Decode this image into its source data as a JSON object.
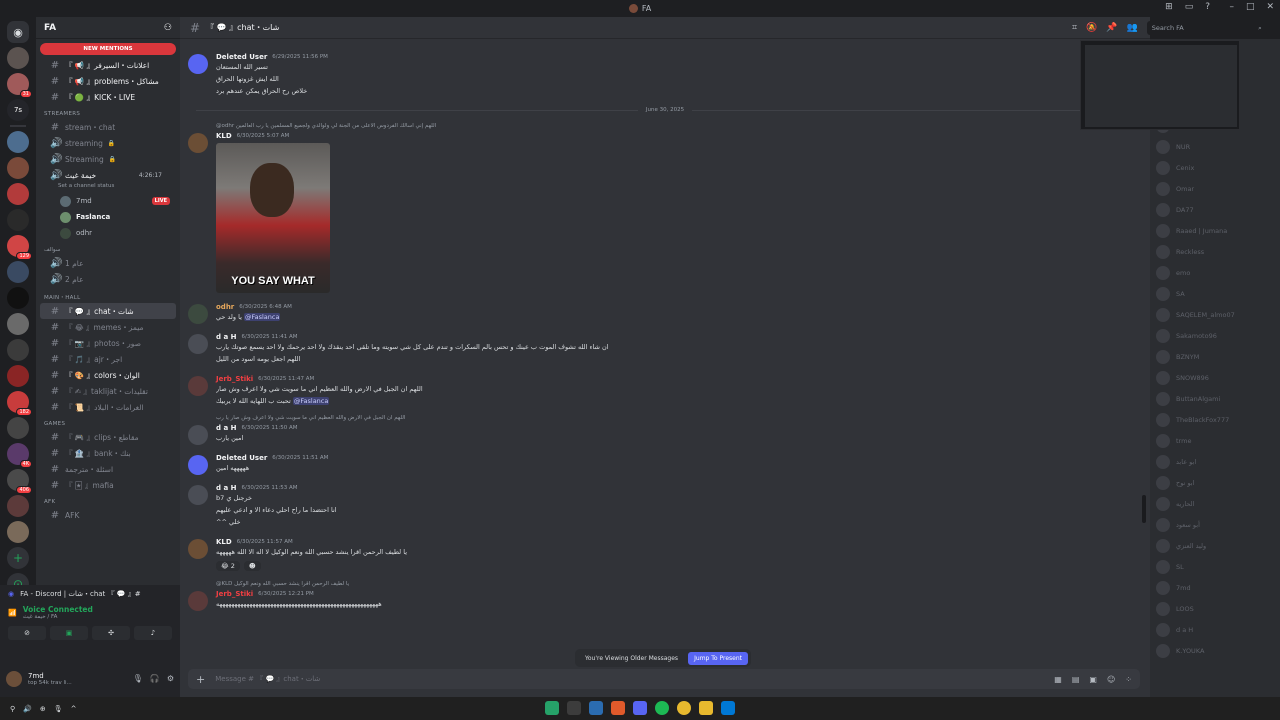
{
  "window": {
    "title": "FA"
  },
  "guild": {
    "name": "FA"
  },
  "sidebar": {
    "new_mentions": "NEW MENTIONS",
    "top_channels": [
      {
        "label": "『 📢 』اعلانات・السيرفر"
      },
      {
        "label": "『 📢 』problems・مشاكل"
      },
      {
        "label": "『 🟢 』KICK・LIVE"
      }
    ],
    "streamers_category": "STREAMERS",
    "streamers_channels": [
      {
        "label": "stream・chat",
        "type": "text"
      },
      {
        "label": "streaming",
        "type": "voice",
        "locked": true
      },
      {
        "label": "Streaming",
        "type": "voice",
        "locked": true
      }
    ],
    "voice_channel": {
      "label": "خيمة غيث",
      "timer": "4:26:17",
      "status": "Set a channel status"
    },
    "voice_users": [
      {
        "name": "7md",
        "live": "LIVE"
      },
      {
        "name": "Faslanca"
      },
      {
        "name": "odhr"
      }
    ],
    "cat2": "سوالف",
    "cat2_channels": [
      {
        "label": "عام 1"
      },
      {
        "label": "عام 2"
      }
    ],
    "main_category": "MAIN・HALL",
    "main_channels": [
      {
        "label": "『 💬 』chat・شات",
        "selected": true
      },
      {
        "label": "『 😂 』memes・ميمز"
      },
      {
        "label": "『 📷 』photos・صور"
      },
      {
        "label": "『 🎵 』ajr・اجر"
      },
      {
        "label": "『 🎨 』colors・الوان"
      },
      {
        "label": "『 ✍ 』taklijat・تقليدات"
      },
      {
        "label": "『 📜 』الغرامات・البلاد"
      }
    ],
    "games_category": "Games",
    "games_channels": [
      {
        "label": "『 🎮 』clips・مقاطع"
      },
      {
        "label": "『 🏦 』bank・بنك"
      },
      {
        "label": "اسئلة・مترجمة"
      },
      {
        "label": "『 🃏 』mafia"
      }
    ],
    "afk_category": "AFK",
    "afk_channels": [
      {
        "label": "AFK"
      }
    ]
  },
  "voice_panel": {
    "activity": "FA - Discord | شات・chat 『 💬 』#",
    "connected": "Voice Connected",
    "channel": "خيمة غيث / FA"
  },
  "user": {
    "name": "7md",
    "status": "top 54k trav li..."
  },
  "chat": {
    "channel": "『 💬 』chat・شات",
    "search_placeholder": "Search FA",
    "date_divider": "June 30, 2025",
    "composer_placeholder": "Message # 『 💬 』chat・شات",
    "viewing_older": "You're Viewing Older Messages",
    "jump_label": "Jump To Present",
    "messages": [
      {
        "user": "Deleted User",
        "ts": "6/29/2025 11:56 PM",
        "lines": [
          "تسير الله المستعان",
          "الله ايش غزوتها الحراق",
          "خلاص رح الحراق يمكن عندهم برد"
        ]
      },
      {
        "user": "KLD",
        "ts": "6/30/2025 5:07 AM",
        "reply": "@odhr اللهم إني أسألك الفردوس الأعلى من الجنة لي ولوالدي ولجميع المسلمين يا رب العالمين",
        "gif_caption": "YOU SAY WHAT"
      },
      {
        "user": "odhr",
        "ts": "6/30/2025 6:48 AM",
        "lines": [
          "يا ولد حي"
        ],
        "mention": "@Faslanca"
      },
      {
        "user": "d a H",
        "ts": "6/30/2025 11:41 AM",
        "lines": [
          "ان شاء الله تشوف الموت ب عينك و تحس بالم السكرات و تندم على كل شي سويته وما تلقى احد ينقذك ولا احد يرحمك ولا احد يسمع صوتك يارب",
          "اللهم اجعل يومه اسود من الليل"
        ]
      },
      {
        "user": "Jerb_Stiki",
        "ts": "6/30/2025 11:47 AM",
        "lines": [
          "اللهم ان الجبل في الارض والله العظيم اني ما سويت شي ولا اعرف وش صار",
          "تحبت ب اللهايه الله لا يربيك"
        ],
        "mention": "@Faslanca"
      },
      {
        "user": "d a H",
        "ts": "6/30/2025 11:50 AM",
        "reply": "اللهم ان الجبل في الارض والله العظيم اني ما سويت شي ولا اعرف وش صار يا رب",
        "lines": [
          "امين يارب"
        ]
      },
      {
        "user": "Deleted User",
        "ts": "6/30/2025 11:51 AM",
        "lines": [
          "هههههه امين"
        ]
      },
      {
        "user": "d a H",
        "ts": "6/30/2025 11:53 AM",
        "lines": [
          "خرجنل ي b7",
          "انا احتضدا ما راح احلي دعاء الا و ادعي عليهم",
          "خلي ^^"
        ]
      },
      {
        "user": "KLD",
        "ts": "6/30/2025 11:57 AM",
        "lines": [
          "يا لطيف الرحمن اقرا ينشد حسبي الله ونعم الوكيل لا اله الا الله هههههه"
        ],
        "reactions": [
          {
            "emoji": "😂",
            "count": "2"
          },
          {
            "emoji": "☻",
            "count": ""
          }
        ]
      },
      {
        "user": "Jerb_Stiki",
        "ts": "6/30/2025 12:21 PM",
        "reply": "@KLD يا لطيف الرحمن اقرا ينشد حسبي الله ونعم الوكيل",
        "lines": [
          "ههههههههههههههههههههههههههههههههههههههههههههههههههههههه"
        ]
      }
    ]
  },
  "members": [
    "RBX Saber",
    "NUR",
    "Cenix",
    "Omar",
    "DA77",
    "Raaed | Jumana",
    "Reckless",
    "emo",
    "SA",
    "SAQELEM_almo07",
    "Sakamoto96",
    "BZNYM",
    "SNOW896",
    "ButtanAlgami",
    "TheBlackFox777",
    "trme",
    "ابو عابد",
    "ابو نوح",
    "الحاريه",
    "أبو سعود",
    "وليد العنزي",
    "SL",
    "7md",
    "LOOS",
    "d a H",
    "K.YOUKA"
  ]
}
